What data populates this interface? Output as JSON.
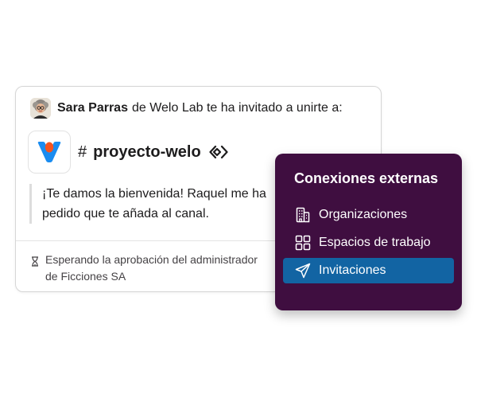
{
  "invite": {
    "sender_name": "Sara Parras",
    "invite_text": "de Welo Lab te ha invitado a unirte a:",
    "channel_hash": "#",
    "channel_name": "proyecto-welo",
    "welcome_message": "¡Te damos la bienvenida! Raquel me ha pedido que te añada al canal.",
    "pending_status": "Esperando la aprobación del administrador de Ficciones SA",
    "icons": {
      "avatar": "sara-parras-avatar",
      "workspace_logo": "welo-logo",
      "shared_channel": "shared-channel-icon",
      "pending": "hourglass-icon"
    }
  },
  "external_connections": {
    "title": "Conexiones externas",
    "items": [
      {
        "label": "Organizaciones",
        "icon": "building-icon",
        "active": false
      },
      {
        "label": "Espacios de trabajo",
        "icon": "grid-icon",
        "active": false
      },
      {
        "label": "Invitaciones",
        "icon": "paper-plane-icon",
        "active": true
      }
    ]
  },
  "colors": {
    "panel_background": "#3f0e40",
    "active_item": "#1264a3",
    "logo_blue": "#1a8cf0",
    "logo_orange": "#f5541f"
  }
}
